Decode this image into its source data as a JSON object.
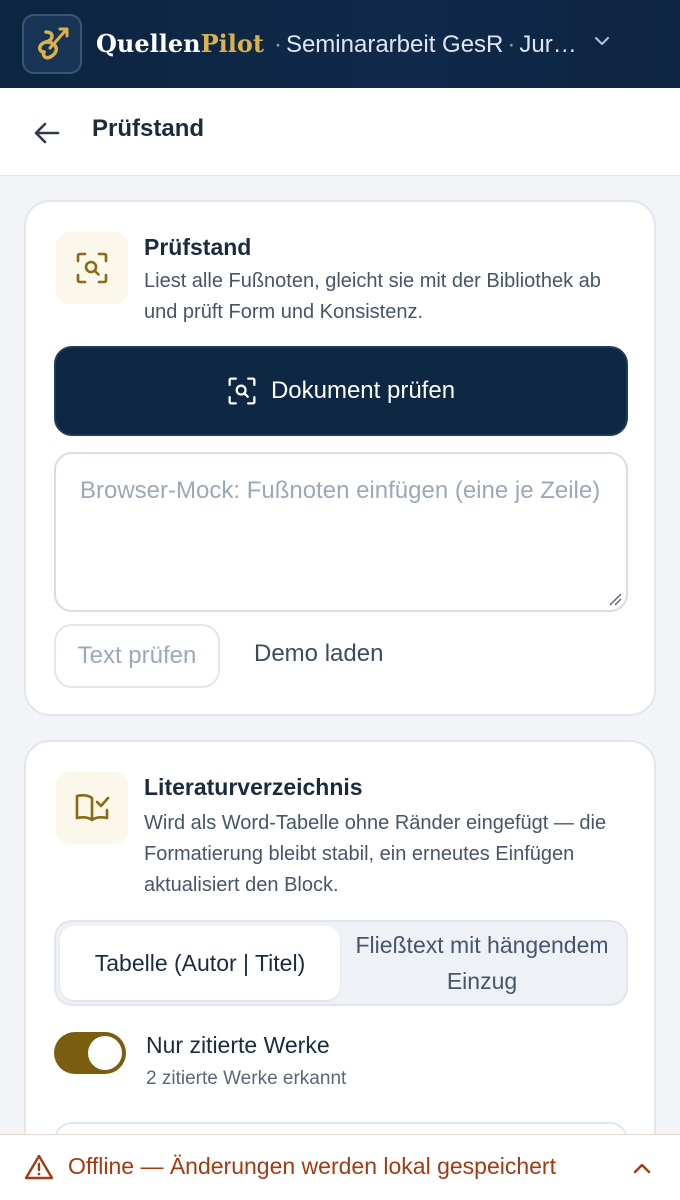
{
  "app": {
    "brand_part1": "Quellen",
    "brand_part2": "Pilot",
    "separator": "·",
    "document_name": "Seminararbeit GesR",
    "document_suffix": "Jur…",
    "accent_color": "#d9b24c",
    "header_color": "#0c2540"
  },
  "subheader": {
    "title": "Prüfstand"
  },
  "check_card": {
    "title": "Prüfstand",
    "description": "Liest alle Fußnoten, gleicht sie mit der Bibliothek ab und prüft Form und Konsistenz.",
    "icon": "scan-search-icon",
    "primary_button": "Dokument prüfen",
    "textarea_placeholder": "Browser-Mock: Fußnoten einfügen (eine je Zeile)",
    "text_check_button": "Text prüfen",
    "demo_button": "Demo laden"
  },
  "bib_card": {
    "title": "Literaturverzeichnis",
    "description": "Wird als Word-Tabelle ohne Ränder eingefügt — die Formatierung bleibt stabil, ein erneutes Einfügen aktualisiert den Block.",
    "icon": "book-check-icon",
    "segments": [
      {
        "label": "Tabelle (Autor | Titel)",
        "selected": true
      },
      {
        "label": "Fließtext mit hängendem Einzug",
        "selected": false
      }
    ],
    "toggle_label": "Nur zitierte Werke",
    "toggle_on": true,
    "toggle_sub": "2 zitierte Werke erkannt",
    "toggle_color": "#7a5d0f"
  },
  "footer": {
    "status": "Offline — Änderungen werden lokal gespeichert",
    "status_color": "#a23b14"
  }
}
